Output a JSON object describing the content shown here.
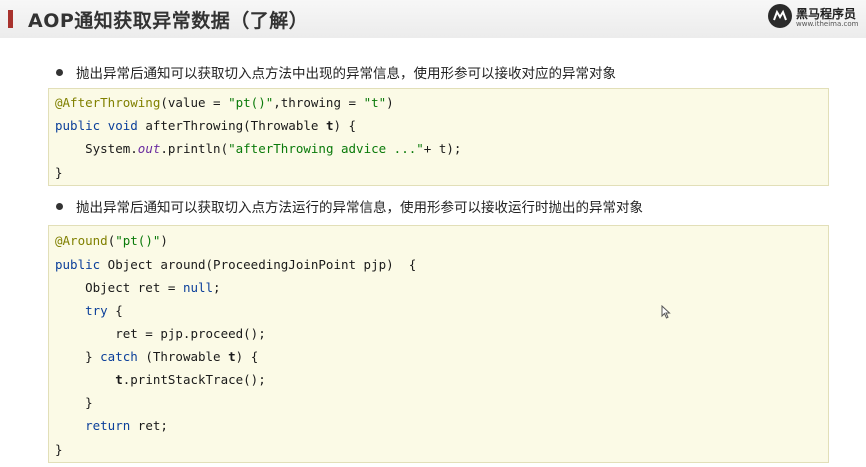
{
  "header": {
    "title": "AOP通知获取异常数据（了解）",
    "logo": {
      "name": "黑马程序员",
      "url_text": "www.itheima.com"
    }
  },
  "bullets": [
    "抛出异常后通知可以获取切入点方法中出现的异常信息，使用形参可以接收对应的异常对象",
    "抛出异常后通知可以获取切入点方法运行的异常信息，使用形参可以接收运行时抛出的异常对象"
  ],
  "code_block_1": {
    "line1": {
      "annotation": "@AfterThrowing",
      "p1": "(value = ",
      "s1": "\"pt()\"",
      "p2": ",throwing = ",
      "s2": "\"t\"",
      "p3": ")"
    },
    "line2": {
      "kw1": "public",
      "kw2": "void",
      "rest": " afterThrowing(Throwable ",
      "param": "t",
      "end": ") {"
    },
    "line3": {
      "p1": "    System.",
      "field": "out",
      "p2": ".println(",
      "s1": "\"afterThrowing advice ...\"",
      "p3": "+ t);"
    },
    "line4": "}"
  },
  "code_block_2": {
    "line1": {
      "annotation": "@Around",
      "p1": "(",
      "s1": "\"pt()\"",
      "p2": ")"
    },
    "line2": {
      "kw1": "public",
      "rest": " Object around(ProceedingJoinPoint pjp)  {"
    },
    "line3": {
      "p1": "    Object ret = ",
      "kw": "null",
      "p2": ";"
    },
    "line4": {
      "indent": "    ",
      "kw": "try",
      "rest": " {"
    },
    "line5": "        ret = pjp.proceed();",
    "line6": {
      "p1": "    } ",
      "kw": "catch",
      "p2": " (Throwable ",
      "param": "t",
      "p3": ") {"
    },
    "line7": {
      "indent": "        ",
      "param": "t",
      "rest": ".printStackTrace();"
    },
    "line8": "    }",
    "line9": {
      "indent": "    ",
      "kw": "return",
      "rest": " ret;"
    },
    "line10": "}"
  },
  "colors": {
    "accent": "#a8322d",
    "code_background": "#fbfae6",
    "keyword": "#0b3f9a",
    "annotation": "#808000",
    "string": "#0a7a0a"
  }
}
